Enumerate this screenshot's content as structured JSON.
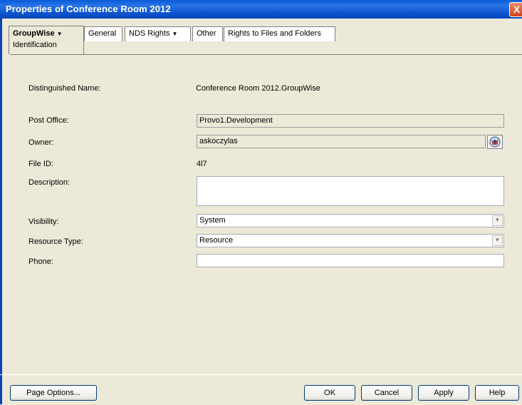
{
  "window": {
    "title": "Properties of Conference Room 2012",
    "close_glyph": "X"
  },
  "tabs": [
    {
      "label": "GroupWise",
      "sub_label": "Identification",
      "has_dropdown": true,
      "active": true
    },
    {
      "label": "General"
    },
    {
      "label": "NDS Rights",
      "has_dropdown": true
    },
    {
      "label": "Other"
    },
    {
      "label": "Rights to Files and Folders"
    }
  ],
  "caret_glyph": "▼",
  "form": {
    "distinguished_name": {
      "label": "Distinguished Name:",
      "value": "Conference Room 2012.GroupWise"
    },
    "post_office": {
      "label": "Post Office:",
      "value": "Provo1.Development"
    },
    "owner": {
      "label": "Owner:",
      "value": "askoczylas",
      "browse_icon": "browse-directory-icon"
    },
    "file_id": {
      "label": "File ID:",
      "value": "4l7"
    },
    "description": {
      "label": "Description:",
      "value": ""
    },
    "visibility": {
      "label": "Visibility:",
      "value": "System"
    },
    "resource_type": {
      "label": "Resource Type:",
      "value": "Resource"
    },
    "phone": {
      "label": "Phone:",
      "value": ""
    }
  },
  "buttons": {
    "page_options": "Page Options...",
    "ok": "OK",
    "cancel": "Cancel",
    "apply": "Apply",
    "help": "Help"
  }
}
